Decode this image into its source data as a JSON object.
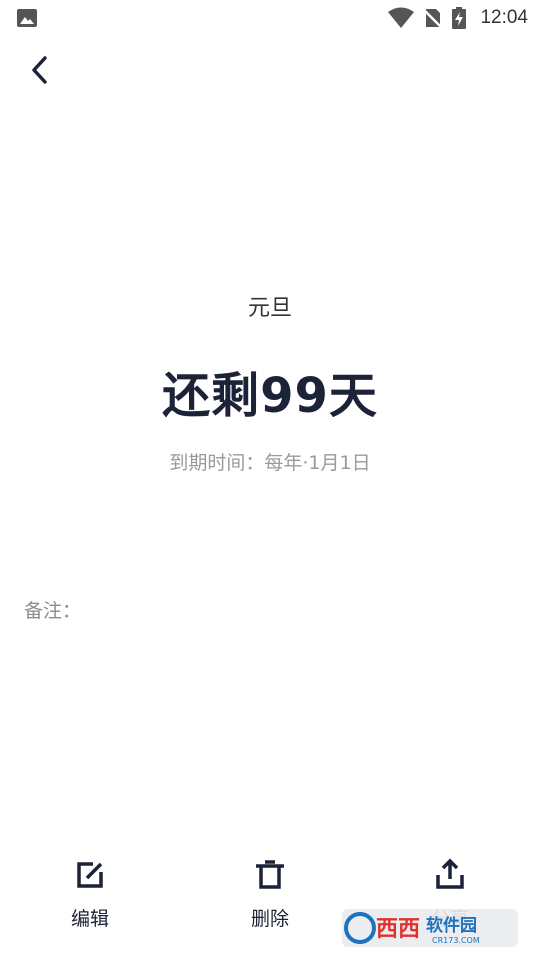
{
  "status_bar": {
    "time": "12:04"
  },
  "event": {
    "title": "元旦",
    "countdown": "还剩99天",
    "due_label": "到期时间：",
    "due_value": "每年·1月1日"
  },
  "note": {
    "label": "备注："
  },
  "actions": {
    "edit": "编辑",
    "delete": "删除",
    "share": "分享"
  },
  "watermark": {
    "text": "西西软件园",
    "subtext": "CR173.COM"
  },
  "colors": {
    "primary": "#1c2237",
    "secondary": "#9a9a9a"
  }
}
